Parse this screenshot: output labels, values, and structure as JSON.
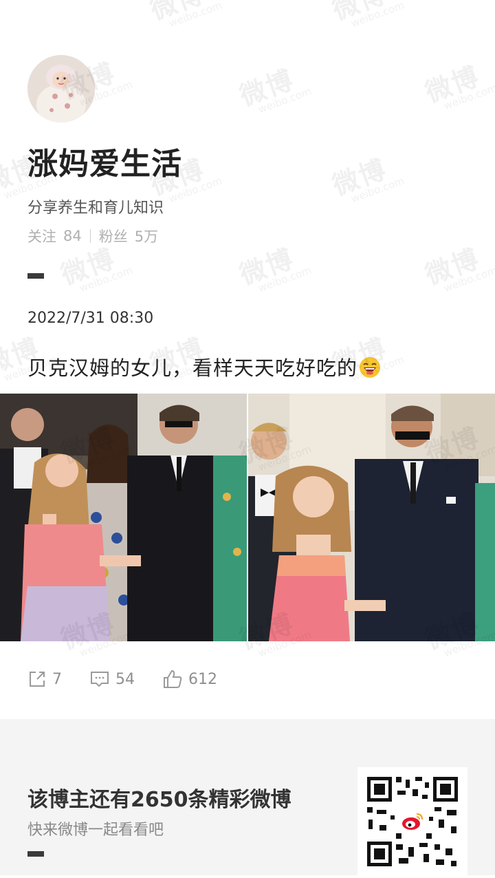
{
  "profile": {
    "nickname": "涨妈爱生活",
    "bio": "分享养生和育儿知识",
    "following_label": "关注",
    "following_count": "84",
    "followers_label": "粉丝",
    "followers_count": "5万"
  },
  "post": {
    "date": "2022/7/31 08:30",
    "text": "贝克汉姆的女儿，看样天天吃好吃的",
    "emoji": "laughing-face-emoji",
    "images": [
      "photo-left",
      "photo-right"
    ]
  },
  "actions": {
    "repost_count": "7",
    "comment_count": "54",
    "like_count": "612"
  },
  "promo": {
    "title": "该博主还有2650条精彩微博",
    "subtitle": "快来微博一起看看吧"
  },
  "watermark": {
    "text": "微博",
    "domain": "weibo.com"
  },
  "icons": [
    "repost-icon",
    "comment-icon",
    "like-icon",
    "qr-code-icon",
    "weibo-logo-icon"
  ],
  "colors": {
    "background": "#ffffff",
    "bottom_panel": "#f4f4f4",
    "text_primary": "#222222",
    "text_muted": "#b0b0b0"
  }
}
